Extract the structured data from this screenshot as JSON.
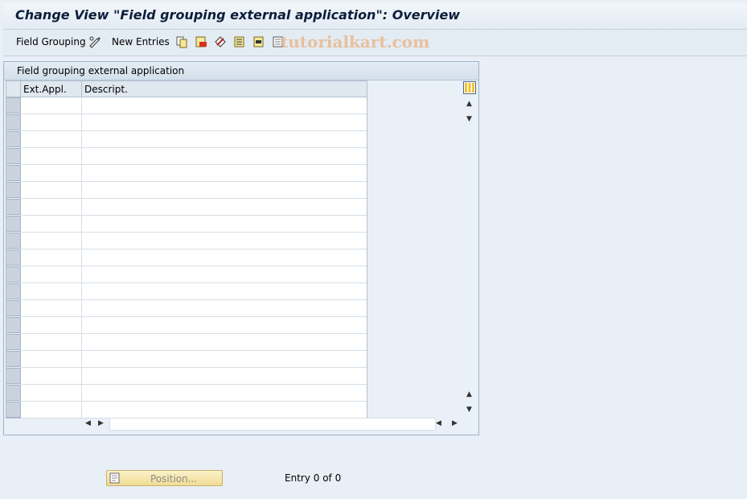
{
  "window": {
    "title": "Change View \"Field grouping external application\": Overview"
  },
  "toolbar": {
    "field_grouping_label": "Field Grouping",
    "new_entries_label": "New Entries",
    "watermark": "tutorialkart.com",
    "icons": [
      "change-icon",
      "copy-icon",
      "delete-icon",
      "undo-icon",
      "select-all-icon",
      "select-block-icon",
      "deselect-all-icon"
    ]
  },
  "table": {
    "title": "Field grouping external application",
    "columns": [
      "Ext.Appl.",
      "Descript."
    ],
    "row_count": 19,
    "rows": []
  },
  "footer": {
    "position_button_label": "Position...",
    "entry_info": "Entry 0 of 0"
  },
  "colors": {
    "background": "#e9eff6",
    "title_text": "#0b1e3a",
    "button_fill": "#f0dc94"
  }
}
